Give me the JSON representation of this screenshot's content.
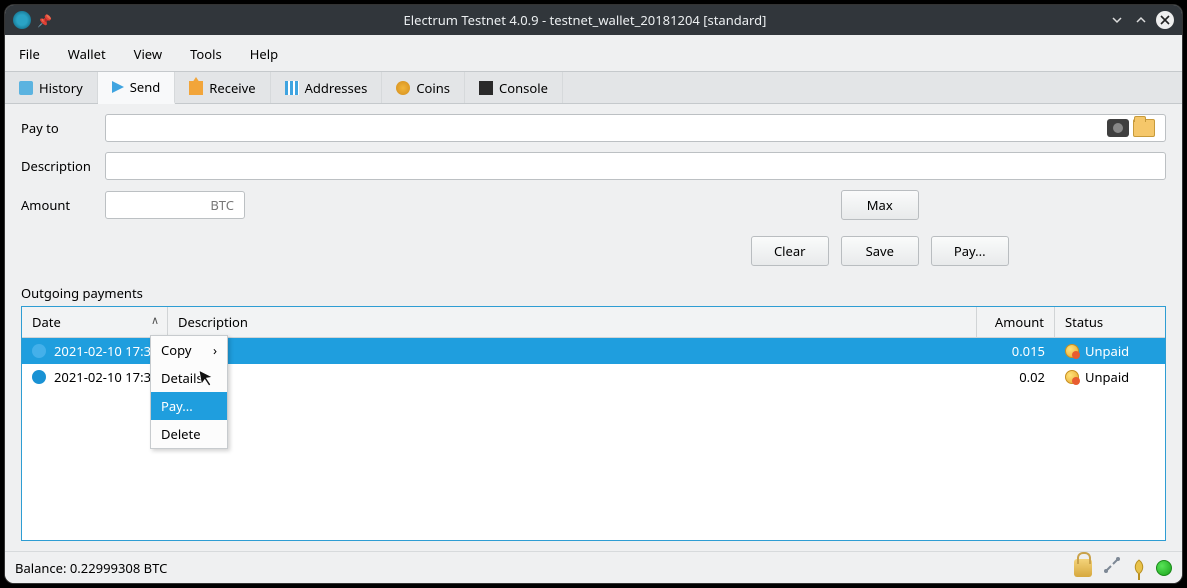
{
  "window": {
    "title": "Electrum Testnet 4.0.9 - testnet_wallet_20181204 [standard]"
  },
  "menubar": {
    "items": [
      "File",
      "Wallet",
      "View",
      "Tools",
      "Help"
    ]
  },
  "tabs": {
    "items": [
      {
        "label": "History",
        "icon": "history"
      },
      {
        "label": "Send",
        "icon": "send"
      },
      {
        "label": "Receive",
        "icon": "receive"
      },
      {
        "label": "Addresses",
        "icon": "addr"
      },
      {
        "label": "Coins",
        "icon": "coins"
      },
      {
        "label": "Console",
        "icon": "console"
      }
    ],
    "active_index": 1
  },
  "form": {
    "payto_label": "Pay to",
    "description_label": "Description",
    "amount_label": "Amount",
    "amount_unit": "BTC",
    "btn_max": "Max",
    "btn_clear": "Clear",
    "btn_save": "Save",
    "btn_pay": "Pay..."
  },
  "outgoing": {
    "title": "Outgoing payments",
    "columns": {
      "date": "Date",
      "description": "Description",
      "amount": "Amount",
      "status": "Status"
    },
    "rows": [
      {
        "date": "2021-02-10 17:37",
        "description": "",
        "amount": "0.015",
        "status": "Unpaid",
        "selected": true
      },
      {
        "date": "2021-02-10 17:36",
        "description": "",
        "amount": "0.02",
        "status": "Unpaid",
        "selected": false
      }
    ]
  },
  "context_menu": {
    "items": [
      "Copy",
      "Details",
      "Pay...",
      "Delete"
    ],
    "highlight_index": 2,
    "submenu_index": 0
  },
  "statusbar": {
    "balance": "Balance: 0.22999308 BTC"
  },
  "icons": {
    "camera": "camera-icon",
    "folder": "folder-icon",
    "lock": "lock-icon",
    "tools": "tools-icon",
    "seed": "seed-icon",
    "network": "network-status-icon"
  }
}
